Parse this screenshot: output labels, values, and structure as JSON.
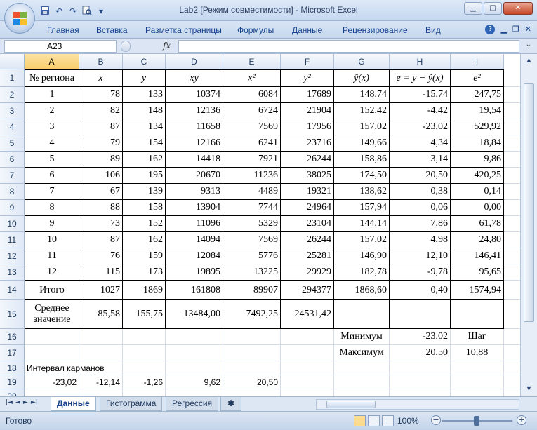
{
  "window": {
    "title": "Lab2  [Режим совместимости] - Microsoft Excel",
    "minimize_icon": "minimize-icon",
    "maximize_icon": "maximize-icon",
    "close_icon": "close-icon"
  },
  "qat": {
    "save_icon": "save-icon",
    "undo_icon": "undo-icon",
    "redo_icon": "redo-icon",
    "print_preview_icon": "print-preview-icon",
    "customize_icon": "chevron-down-icon"
  },
  "ribbon": {
    "tabs": [
      "Главная",
      "Вставка",
      "Разметка страницы",
      "Формулы",
      "Данные",
      "Рецензирование",
      "Вид"
    ],
    "help_glyph": "?"
  },
  "formula_bar": {
    "name_box": "A23",
    "fx_label": "fx",
    "formula": ""
  },
  "columns": [
    "A",
    "B",
    "C",
    "D",
    "E",
    "F",
    "G",
    "H",
    "I"
  ],
  "rows": [
    "1",
    "2",
    "3",
    "4",
    "5",
    "6",
    "7",
    "8",
    "9",
    "10",
    "11",
    "12",
    "13",
    "14",
    "15",
    "16",
    "17",
    "18",
    "19",
    "20"
  ],
  "cells": {
    "r1": [
      "№ региона",
      "x",
      "y",
      "xy",
      "x²",
      "y²",
      "ŷ(x)",
      "e = y − ŷ(x)",
      "e²"
    ],
    "data": [
      [
        "1",
        "78",
        "133",
        "10374",
        "6084",
        "17689",
        "148,74",
        "-15,74",
        "247,75"
      ],
      [
        "2",
        "82",
        "148",
        "12136",
        "6724",
        "21904",
        "152,42",
        "-4,42",
        "19,54"
      ],
      [
        "3",
        "87",
        "134",
        "11658",
        "7569",
        "17956",
        "157,02",
        "-23,02",
        "529,92"
      ],
      [
        "4",
        "79",
        "154",
        "12166",
        "6241",
        "23716",
        "149,66",
        "4,34",
        "18,84"
      ],
      [
        "5",
        "89",
        "162",
        "14418",
        "7921",
        "26244",
        "158,86",
        "3,14",
        "9,86"
      ],
      [
        "6",
        "106",
        "195",
        "20670",
        "11236",
        "38025",
        "174,50",
        "20,50",
        "420,25"
      ],
      [
        "7",
        "67",
        "139",
        "9313",
        "4489",
        "19321",
        "138,62",
        "0,38",
        "0,14"
      ],
      [
        "8",
        "88",
        "158",
        "13904",
        "7744",
        "24964",
        "157,94",
        "0,06",
        "0,00"
      ],
      [
        "9",
        "73",
        "152",
        "11096",
        "5329",
        "23104",
        "144,14",
        "7,86",
        "61,78"
      ],
      [
        "10",
        "87",
        "162",
        "14094",
        "7569",
        "26244",
        "157,02",
        "4,98",
        "24,80"
      ],
      [
        "11",
        "76",
        "159",
        "12084",
        "5776",
        "25281",
        "146,90",
        "12,10",
        "146,41"
      ],
      [
        "12",
        "115",
        "173",
        "19895",
        "13225",
        "29929",
        "182,78",
        "-9,78",
        "95,65"
      ]
    ],
    "r14": [
      "Итого",
      "1027",
      "1869",
      "161808",
      "89907",
      "294377",
      "1868,60",
      "0,40",
      "1574,94"
    ],
    "r15": [
      "Среднее значение",
      "85,58",
      "155,75",
      "13484,00",
      "7492,25",
      "24531,42",
      "",
      "",
      ""
    ],
    "r16": {
      "label": "Минимум",
      "value": "-23,02",
      "step_label": "Шаг"
    },
    "r17": {
      "label": "Максимум",
      "value": "20,50",
      "step_value": "10,88"
    },
    "r18": {
      "label": "Интервал карманов"
    },
    "r19": [
      "-23,02",
      "-12,14",
      "-1,26",
      "9,62",
      "20,50"
    ]
  },
  "sheets": {
    "tabs": [
      "Данные",
      "Гистограмма",
      "Регрессия"
    ],
    "active": "Данные",
    "nav_first": "|◄",
    "nav_prev": "◄",
    "nav_next": "►",
    "nav_last": "►|"
  },
  "status": {
    "text": "Готово",
    "zoom": "100%",
    "zoom_out": "−",
    "zoom_in": "+"
  }
}
